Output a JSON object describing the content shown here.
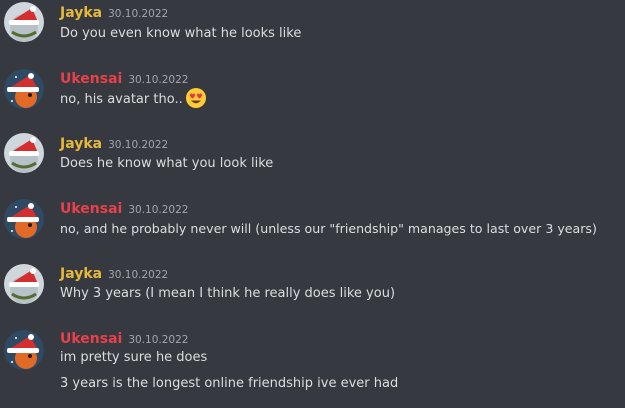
{
  "colors": {
    "background": "#36393f",
    "jayka_name": "#e6b93a",
    "ukensai_name": "#e8414b",
    "message_text": "#dcddde",
    "timestamp": "#a3a6aa"
  },
  "messages": [
    {
      "author": "Jayka",
      "timestamp": "30.10.2022",
      "lines": [
        "Do you even know what he looks like"
      ]
    },
    {
      "author": "Ukensai",
      "timestamp": "30.10.2022",
      "lines": [
        "no, his avatar tho.."
      ],
      "emoji": "heart-eyes-emoji"
    },
    {
      "author": "Jayka",
      "timestamp": "30.10.2022",
      "lines": [
        "Does he know what you look like"
      ]
    },
    {
      "author": "Ukensai",
      "timestamp": "30.10.2022",
      "lines": [
        "no, and he probably never will (unless our \"friendship\" manages to last over 3 years)"
      ]
    },
    {
      "author": "Jayka",
      "timestamp": "30.10.2022",
      "lines": [
        "Why 3 years (I mean I think he really does like you)"
      ]
    },
    {
      "author": "Ukensai",
      "timestamp": "30.10.2022",
      "lines": [
        "im pretty sure he does",
        "3 years is the longest online friendship ive ever had"
      ]
    }
  ]
}
